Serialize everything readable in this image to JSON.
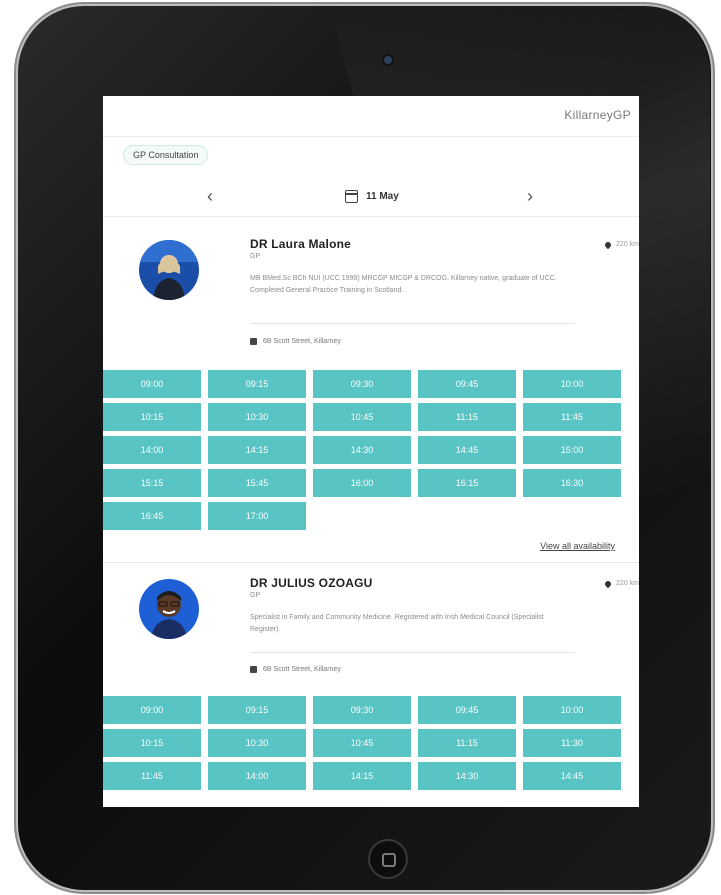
{
  "app": {
    "brand": "KillarneyGP"
  },
  "filter_chip": "GP Consultation",
  "date_nav": {
    "date": "11 May",
    "prev_icon": "chevron-left-icon",
    "next_icon": "chevron-right-icon"
  },
  "doctors": [
    {
      "name": "DR Laura Malone",
      "role": "GP",
      "bio": "MB BMed.Sc BCh NUI (UCC 1999) MRCGP MICGP & DRCOG. Killarney native, graduate of UCC. Completed General Practice Training in Scotland.",
      "address": "6B Scott Street, Killarney",
      "distance": "220 km",
      "slots": [
        "09:00",
        "09:15",
        "09:30",
        "09:45",
        "10:00",
        "10:15",
        "10:30",
        "10:45",
        "11:15",
        "11:45",
        "14:00",
        "14:15",
        "14:30",
        "14:45",
        "15:00",
        "15:15",
        "15:45",
        "16:00",
        "16:15",
        "16:30",
        "16:45",
        "17:00"
      ],
      "view_all": "View all availability"
    },
    {
      "name": "DR JULIUS OZOAGU",
      "role": "GP",
      "bio": "Specialist in Family and Community Medicine. Registered with Irish Medical Council (Specialist Register).",
      "address": "6B Scott Street, Killarney",
      "distance": "220 km",
      "slots": [
        "09:00",
        "09:15",
        "09:30",
        "09:45",
        "10:00",
        "10:15",
        "10:30",
        "10:45",
        "11:15",
        "11:30",
        "11:45",
        "14:00",
        "14:15",
        "14:30",
        "14:45"
      ]
    }
  ],
  "colors": {
    "slot": "#58c4c4",
    "device": "#111111"
  }
}
